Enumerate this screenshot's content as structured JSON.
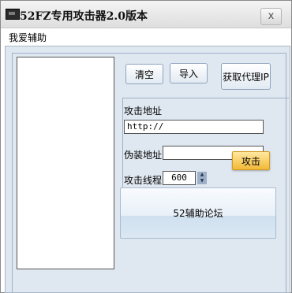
{
  "window": {
    "title": "52FZ专用攻击器2.0版本",
    "close_label": "x"
  },
  "menu": {
    "items": [
      "我爱辅助"
    ]
  },
  "toolbar": {
    "clear_label": "清空",
    "import_label": "导入",
    "get_proxy_label": "获取代理IP"
  },
  "attack": {
    "address_label": "攻击地址",
    "address_value": "http://",
    "disguise_label": "伪装地址",
    "disguise_value": "",
    "threads_label": "攻击线程",
    "threads_value": "600",
    "attack_button": "攻击"
  },
  "footer": {
    "forum_button": "52辅助论坛"
  },
  "colors": {
    "panel_bg": "#dfe7f0",
    "attack_button_bg": "#f2b936"
  }
}
